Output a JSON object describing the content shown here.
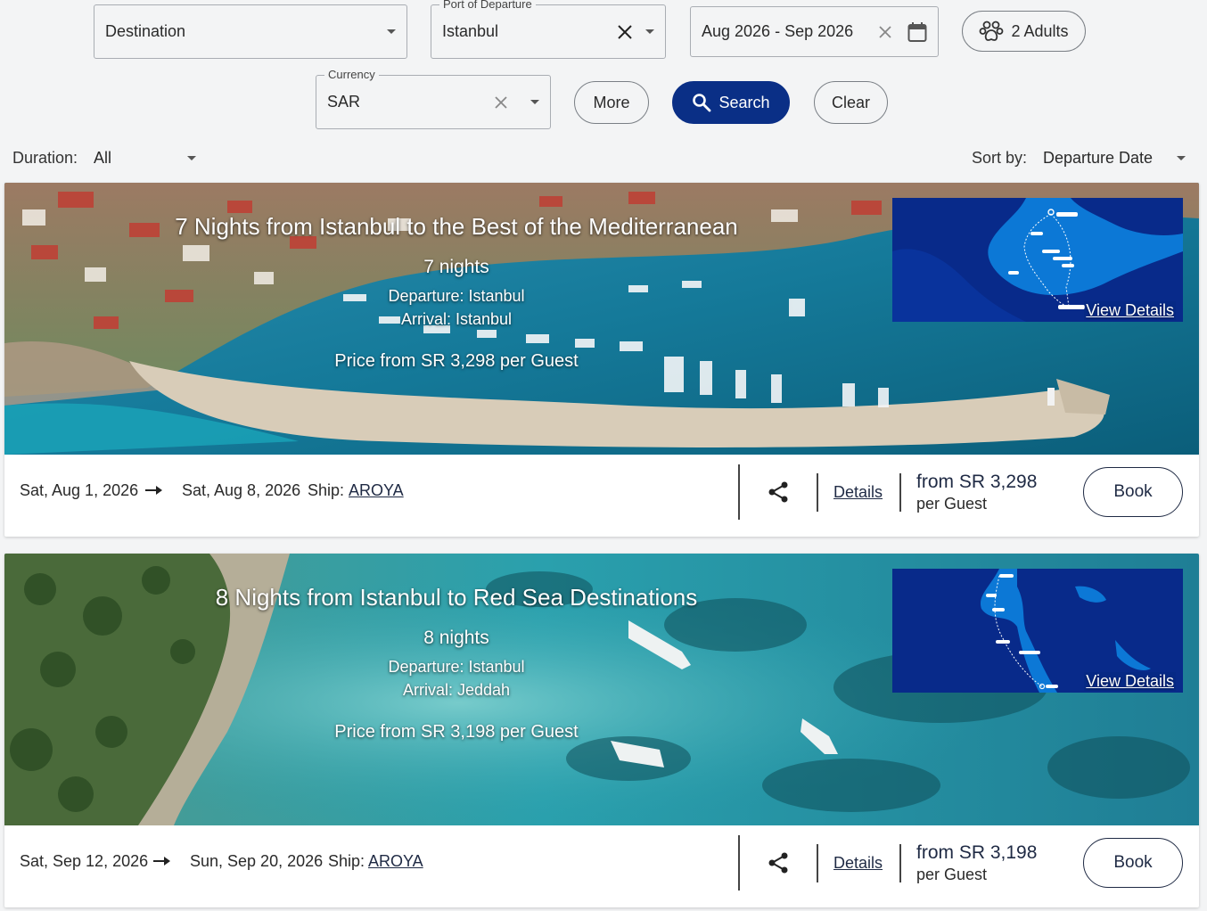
{
  "filters": {
    "destination": {
      "value": "Destination"
    },
    "port": {
      "label": "Port of Departure",
      "value": "Istanbul"
    },
    "dates": {
      "value": "Aug 2026 - Sep 2026"
    },
    "guests": {
      "value": "2 Adults"
    },
    "currency": {
      "label": "Currency",
      "value": "SAR"
    },
    "more_label": "More",
    "search_label": "Search",
    "clear_label": "Clear"
  },
  "toolbar": {
    "duration_label": "Duration:",
    "duration_value": "All",
    "sort_label": "Sort by:",
    "sort_value": "Departure Date"
  },
  "cruises": [
    {
      "title": "7 Nights from Istanbul to the Best of the Mediterranean",
      "nights": "7 nights",
      "departure": "Departure: Istanbul",
      "arrival": "Arrival: Istanbul",
      "price_banner": "Price from SR 3,298 per Guest",
      "view_details": "View Details",
      "start_date": "Sat, Aug 1, 2026",
      "end_date": "Sat, Aug 8, 2026",
      "ship_label": "Ship:",
      "ship": "AROYA",
      "details": "Details",
      "price": "from SR 3,298",
      "price_unit": "per Guest",
      "book": "Book"
    },
    {
      "title": "8 Nights from Istanbul to Red Sea Destinations",
      "nights": "8 nights",
      "departure": "Departure: Istanbul",
      "arrival": "Arrival: Jeddah",
      "price_banner": "Price from SR 3,198 per Guest",
      "view_details": "View Details",
      "start_date": "Sat, Sep 12, 2026",
      "end_date": "Sun, Sep 20, 2026",
      "ship_label": "Ship:",
      "ship": "AROYA",
      "details": "Details",
      "price": "from SR 3,198",
      "price_unit": "per Guest",
      "book": "Book"
    }
  ],
  "colors": {
    "primary": "#0a2f86",
    "map_sea": "#0c78d6",
    "map_land": "#082a8a",
    "text": "#2a2a2a"
  }
}
